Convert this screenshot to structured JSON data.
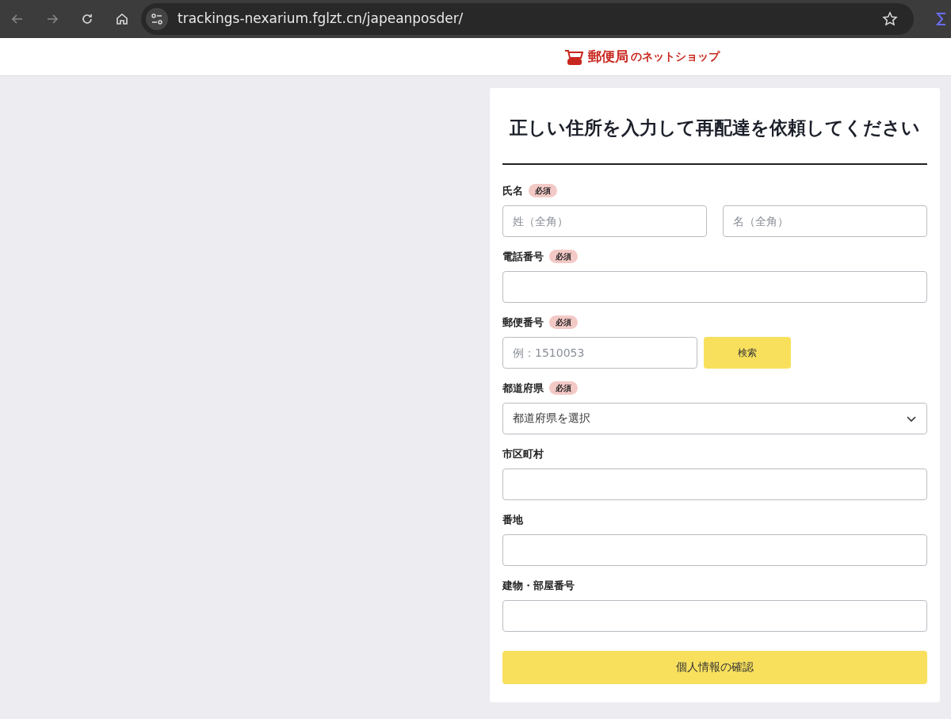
{
  "browser": {
    "url": "trackings-nexarium.fglzt.cn/japeanposder/"
  },
  "header": {
    "logo_text": "郵便局",
    "logo_suffix": "のネットショップ"
  },
  "form": {
    "title": "正しい住所を入力して再配達を依頼してください",
    "fields": [
      {
        "kind": "name",
        "label": "氏名",
        "required": true,
        "badge": "必須",
        "placeholders": [
          "姓（全角）",
          "名（全角）"
        ]
      },
      {
        "kind": "text",
        "label": "電話番号",
        "required": true,
        "badge": "必須"
      },
      {
        "kind": "postal",
        "label": "郵便番号",
        "required": true,
        "badge": "必須",
        "placeholder": "例：1510053",
        "button": "検索"
      },
      {
        "kind": "select",
        "label": "都道府県",
        "required": true,
        "badge": "必須",
        "value": "都道府県を選択"
      },
      {
        "kind": "text",
        "label": "市区町村",
        "required": false
      },
      {
        "kind": "text",
        "label": "番地",
        "required": false
      },
      {
        "kind": "text",
        "label": "建物・部屋番号",
        "required": false
      }
    ],
    "submit": "個人情報の確認"
  }
}
